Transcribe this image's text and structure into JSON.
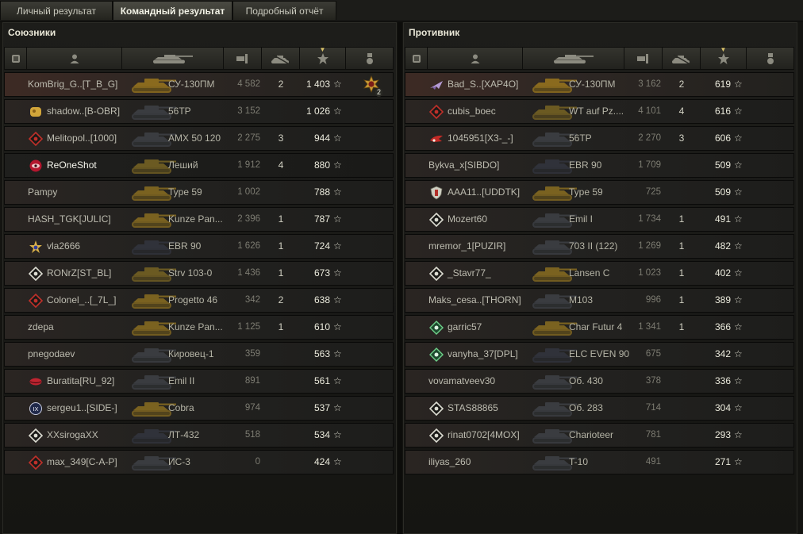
{
  "tabs": [
    "Личный результат",
    "Командный результат",
    "Подробный отчёт"
  ],
  "active_tab": 1,
  "allies": {
    "title": "Союзники",
    "rows": [
      {
        "player": "KomBrig_G..[T_B_G]",
        "icon": "none",
        "vehicle": "СУ-130ПМ",
        "tank_class": "spg",
        "damage": "4 582",
        "kills": "2",
        "xp": "1 403",
        "medal": "2",
        "style": "hl"
      },
      {
        "player": "shadow..[B-OBR]",
        "icon": "clan-gold-icon",
        "vehicle": "56TP",
        "tank_class": "heavy",
        "damage": "3 152",
        "kills": "",
        "xp": "1 026",
        "medal": "",
        "style": ""
      },
      {
        "player": "Melitopol..[1000]",
        "icon": "clan-diamond-red-icon",
        "vehicle": "AMX 50 120",
        "tank_class": "heavy",
        "damage": "2 275",
        "kills": "3",
        "xp": "944",
        "medal": "",
        "style": ""
      },
      {
        "player": "ReOneShot",
        "icon": "clan-red-eye-icon",
        "vehicle": "Леший",
        "tank_class": "td",
        "damage": "1 912",
        "kills": "4",
        "xp": "880",
        "medal": "",
        "style": "self"
      },
      {
        "player": "Pampy",
        "icon": "none",
        "vehicle": "Type 59",
        "tank_class": "medium",
        "damage": "1 002",
        "kills": "",
        "xp": "788",
        "medal": "",
        "style": ""
      },
      {
        "player": "HASH_TGK[JULIC]",
        "icon": "none",
        "vehicle": "Kunze Pan...",
        "tank_class": "medium",
        "damage": "2 396",
        "kills": "1",
        "xp": "787",
        "medal": "",
        "style": ""
      },
      {
        "player": "vla2666",
        "icon": "clan-gold-star-icon",
        "vehicle": "EBR 90",
        "tank_class": "light",
        "damage": "1 626",
        "kills": "1",
        "xp": "724",
        "medal": "",
        "style": ""
      },
      {
        "player": "RONrZ[ST_BL]",
        "icon": "clan-diamond-white-icon",
        "vehicle": "Strv 103-0",
        "tank_class": "td",
        "damage": "1 436",
        "kills": "1",
        "xp": "673",
        "medal": "",
        "style": ""
      },
      {
        "player": "Colonel_..[_7L_]",
        "icon": "clan-diamond-red-icon",
        "vehicle": "Progetto 46",
        "tank_class": "medium",
        "damage": "342",
        "kills": "2",
        "xp": "638",
        "medal": "",
        "style": ""
      },
      {
        "player": "zdepa",
        "icon": "none",
        "vehicle": "Kunze Pan...",
        "tank_class": "medium",
        "damage": "1 125",
        "kills": "1",
        "xp": "610",
        "medal": "",
        "style": ""
      },
      {
        "player": "pnegodaev",
        "icon": "none",
        "vehicle": "Кировец-1",
        "tank_class": "heavy",
        "damage": "359",
        "kills": "",
        "xp": "563",
        "medal": "",
        "style": ""
      },
      {
        "player": "Buratita[RU_92]",
        "icon": "clan-red-lips-icon",
        "vehicle": "Emil II",
        "tank_class": "heavy",
        "damage": "891",
        "kills": "",
        "xp": "561",
        "medal": "",
        "style": ""
      },
      {
        "player": "sergeu1..[SIDE-]",
        "icon": "clan-ix-icon",
        "vehicle": "Cobra",
        "tank_class": "medium",
        "damage": "974",
        "kills": "",
        "xp": "537",
        "medal": "",
        "style": ""
      },
      {
        "player": "XXsirogaXX",
        "icon": "clan-diamond-white-icon",
        "vehicle": "ЛТ-432",
        "tank_class": "light",
        "damage": "518",
        "kills": "",
        "xp": "534",
        "medal": "",
        "style": ""
      },
      {
        "player": "max_349[C-A-P]",
        "icon": "clan-diamond-red-icon",
        "vehicle": "ИС-3",
        "tank_class": "heavy",
        "damage": "0",
        "kills": "",
        "xp": "424",
        "medal": "",
        "style": ""
      }
    ]
  },
  "enemies": {
    "title": "Противник",
    "rows": [
      {
        "player": "Bad_S..[XAP4O]",
        "icon": "clan-plane-icon",
        "vehicle": "СУ-130ПМ",
        "tank_class": "spg",
        "damage": "3 162",
        "kills": "2",
        "xp": "619",
        "medal": "",
        "style": "hl"
      },
      {
        "player": "cubis_boec",
        "icon": "clan-diamond-red-icon",
        "vehicle": "WT auf Pz....",
        "tank_class": "td",
        "damage": "4 101",
        "kills": "4",
        "xp": "616",
        "medal": "",
        "style": ""
      },
      {
        "player": "1045951[X3-_-]",
        "icon": "clan-red-wings-icon",
        "vehicle": "56TP",
        "tank_class": "heavy",
        "damage": "2 270",
        "kills": "3",
        "xp": "606",
        "medal": "",
        "style": ""
      },
      {
        "player": "Bykva_x[SIBDO]",
        "icon": "none",
        "vehicle": "EBR 90",
        "tank_class": "light",
        "damage": "1 709",
        "kills": "",
        "xp": "509",
        "medal": "",
        "style": ""
      },
      {
        "player": "AAA11..[UDDTK]",
        "icon": "clan-shield-icon",
        "vehicle": "Type 59",
        "tank_class": "medium",
        "damage": "725",
        "kills": "",
        "xp": "509",
        "medal": "",
        "style": ""
      },
      {
        "player": "Mozert60",
        "icon": "clan-diamond-white-icon",
        "vehicle": "Emil I",
        "tank_class": "heavy",
        "damage": "1 734",
        "kills": "1",
        "xp": "491",
        "medal": "",
        "style": ""
      },
      {
        "player": "mremor_1[PUZIR]",
        "icon": "none",
        "vehicle": "703 II (122)",
        "tank_class": "heavy",
        "damage": "1 269",
        "kills": "1",
        "xp": "482",
        "medal": "",
        "style": ""
      },
      {
        "player": "_Stavr77_",
        "icon": "clan-diamond-white-icon",
        "vehicle": "Lansen C",
        "tank_class": "medium",
        "damage": "1 023",
        "kills": "1",
        "xp": "402",
        "medal": "",
        "style": ""
      },
      {
        "player": "Maks_cesa..[THORN]",
        "icon": "none",
        "vehicle": "M103",
        "tank_class": "heavy",
        "damage": "996",
        "kills": "1",
        "xp": "389",
        "medal": "",
        "style": ""
      },
      {
        "player": "garric57",
        "icon": "clan-green-icon",
        "vehicle": "Char Futur 4",
        "tank_class": "medium",
        "damage": "1 341",
        "kills": "1",
        "xp": "366",
        "medal": "",
        "style": ""
      },
      {
        "player": "vanyha_37[DPL]",
        "icon": "clan-green-icon",
        "vehicle": "ELC EVEN 90",
        "tank_class": "light",
        "damage": "675",
        "kills": "",
        "xp": "342",
        "medal": "",
        "style": ""
      },
      {
        "player": "vovamatveev30",
        "icon": "none",
        "vehicle": "Об. 430",
        "tank_class": "heavy",
        "damage": "378",
        "kills": "",
        "xp": "336",
        "medal": "",
        "style": ""
      },
      {
        "player": "STAS88865",
        "icon": "clan-diamond-white-icon",
        "vehicle": "Об. 283",
        "tank_class": "heavy",
        "damage": "714",
        "kills": "",
        "xp": "304",
        "medal": "",
        "style": ""
      },
      {
        "player": "rinat0702[4MOX]",
        "icon": "clan-diamond-white-icon",
        "vehicle": "Charioteer",
        "tank_class": "heavy",
        "damage": "781",
        "kills": "",
        "xp": "293",
        "medal": "",
        "style": ""
      },
      {
        "player": "iliyas_260",
        "icon": "none",
        "vehicle": "T-10",
        "tank_class": "heavy",
        "damage": "491",
        "kills": "",
        "xp": "271",
        "medal": "",
        "style": ""
      }
    ]
  },
  "column_icons": [
    "squad-icon",
    "player-icon",
    "tank-icon",
    "damage-icon",
    "kills-icon",
    "xp-icon",
    "medal-icon"
  ],
  "colors": {
    "accent": "#d9c26a",
    "text": "#bdbcb0",
    "highlight_row": "#3d2a24",
    "tank_gold": "#8a6a1e"
  }
}
